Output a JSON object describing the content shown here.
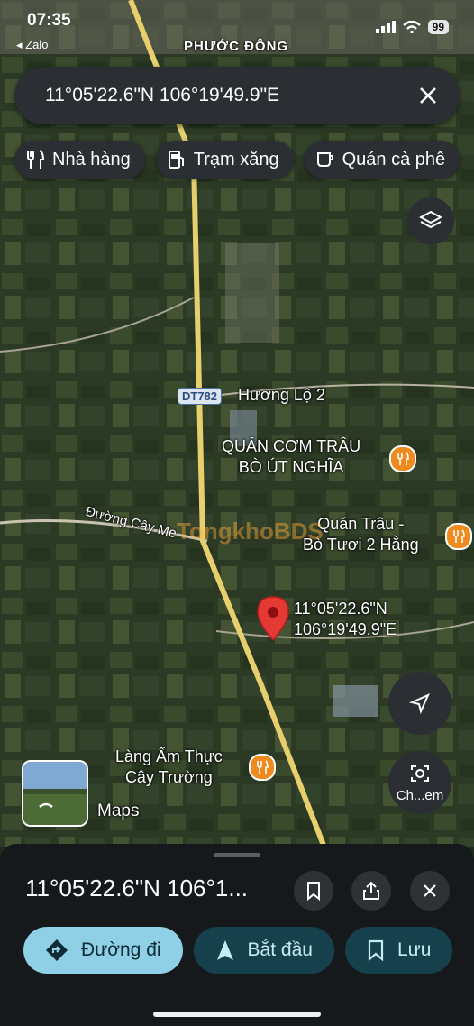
{
  "status_bar": {
    "time": "07:35",
    "back_app": "◂ Zalo",
    "battery": "99"
  },
  "search": {
    "query": "11°05'22.6\"N 106°19'49.9\"E"
  },
  "chips": [
    {
      "label": "Nhà hàng",
      "icon": "restaurant-icon"
    },
    {
      "label": "Trạm xăng",
      "icon": "gas-station-icon"
    },
    {
      "label": "Quán cà phê",
      "icon": "coffee-icon"
    }
  ],
  "map": {
    "place_label_top": "PHƯỚC ĐÔNG",
    "road_badge": "DT782",
    "road_huong_lo": "Hương Lộ 2",
    "road_cay_me": "Đường Cây Me",
    "poi_1": {
      "line1": "QUÁN CƠM TRÂU",
      "line2": "BÒ ÚT NGHĨA"
    },
    "poi_2": {
      "line1": "Quán Trâu -",
      "line2": "Bò Tươi 2 Hằng"
    },
    "poi_3": {
      "line1": "Làng Ẩm Thực",
      "line2": "Cây Trường"
    },
    "pin_label": {
      "line1": "11°05'22.6\"N",
      "line2": "106°19'49.9\"E"
    },
    "watermark": "TongkhoBDS",
    "maps_label": "Maps",
    "camera_label": "Ch...em"
  },
  "sheet": {
    "title": "11°05'22.6\"N 106°1...",
    "actions": [
      {
        "label": "Đường đi"
      },
      {
        "label": "Bắt đầu"
      },
      {
        "label": "Lưu"
      }
    ]
  },
  "colors": {
    "accent": "#8fd0e6",
    "poi": "#ef8a1e",
    "pin": "#e53935"
  }
}
